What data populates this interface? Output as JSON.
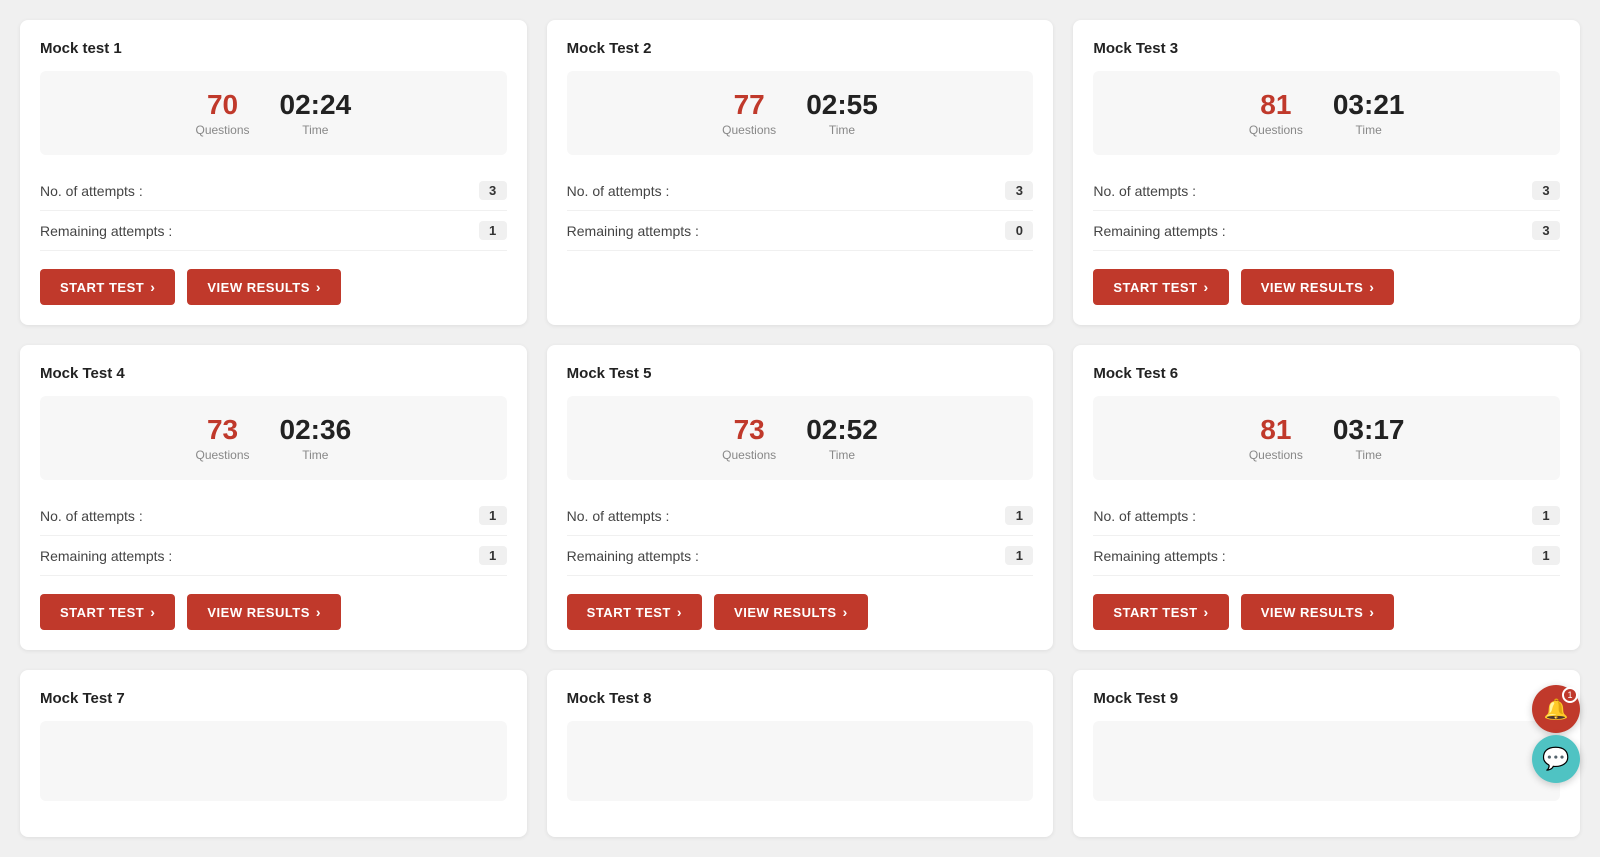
{
  "cards": [
    {
      "id": "mock-test-1",
      "title": "Mock test 1",
      "questions": "70",
      "time": "02:24",
      "no_of_attempts": "3",
      "remaining_attempts": "1",
      "show_start": true,
      "show_view": true
    },
    {
      "id": "mock-test-2",
      "title": "Mock Test 2",
      "questions": "77",
      "time": "02:55",
      "no_of_attempts": "3",
      "remaining_attempts": "0",
      "show_start": false,
      "show_view": false
    },
    {
      "id": "mock-test-3",
      "title": "Mock Test 3",
      "questions": "81",
      "time": "03:21",
      "no_of_attempts": "3",
      "remaining_attempts": "3",
      "show_start": true,
      "show_view": true
    },
    {
      "id": "mock-test-4",
      "title": "Mock Test 4",
      "questions": "73",
      "time": "02:36",
      "no_of_attempts": "1",
      "remaining_attempts": "1",
      "show_start": true,
      "show_view": true
    },
    {
      "id": "mock-test-5",
      "title": "Mock Test 5",
      "questions": "73",
      "time": "02:52",
      "no_of_attempts": "1",
      "remaining_attempts": "1",
      "show_start": true,
      "show_view": true
    },
    {
      "id": "mock-test-6",
      "title": "Mock Test 6",
      "questions": "81",
      "time": "03:17",
      "no_of_attempts": "1",
      "remaining_attempts": "1",
      "show_start": true,
      "show_view": true
    },
    {
      "id": "mock-test-7",
      "title": "Mock Test 7",
      "questions": "",
      "time": "",
      "no_of_attempts": "",
      "remaining_attempts": "",
      "show_start": false,
      "show_view": false
    },
    {
      "id": "mock-test-8",
      "title": "Mock Test 8",
      "questions": "",
      "time": "",
      "no_of_attempts": "",
      "remaining_attempts": "",
      "show_start": false,
      "show_view": false
    },
    {
      "id": "mock-test-9",
      "title": "Mock Test 9",
      "questions": "",
      "time": "",
      "no_of_attempts": "",
      "remaining_attempts": "",
      "show_start": false,
      "show_view": false
    }
  ],
  "labels": {
    "questions": "Questions",
    "time": "Time",
    "no_of_attempts": "No. of attempts :",
    "remaining_attempts": "Remaining attempts :",
    "start_test": "START TEST",
    "view_results": "VIEW RESULTS"
  },
  "notif_count": "1"
}
